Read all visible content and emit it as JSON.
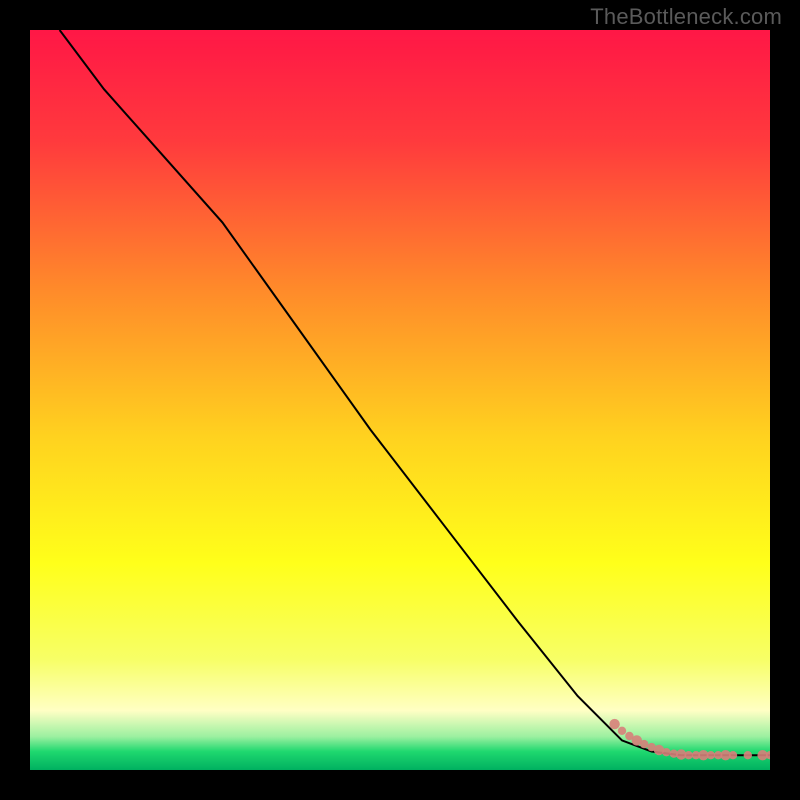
{
  "watermark": "TheBottleneck.com",
  "chart_data": {
    "type": "line",
    "title": "",
    "xlabel": "",
    "ylabel": "",
    "xlim": [
      0,
      100
    ],
    "ylim": [
      0,
      100
    ],
    "grid": false,
    "legend": false,
    "series": [
      {
        "name": "curve",
        "style": "line",
        "color": "#000000",
        "x": [
          4,
          10,
          18,
          26,
          36,
          46,
          56,
          66,
          74,
          80,
          84,
          88,
          92,
          96,
          100
        ],
        "values": [
          100,
          92,
          83,
          74,
          60,
          46,
          33,
          20,
          10,
          4,
          2.5,
          2,
          2,
          2,
          2
        ]
      },
      {
        "name": "bottom-markers",
        "style": "scatter",
        "color": "#d77f7a",
        "x": [
          79,
          80,
          81,
          82,
          83,
          84,
          85,
          86,
          87,
          88,
          89,
          90,
          91,
          92,
          93,
          94,
          95,
          97,
          99,
          100
        ],
        "values": [
          6.2,
          5.3,
          4.6,
          4.0,
          3.5,
          3.1,
          2.7,
          2.4,
          2.2,
          2.1,
          2.0,
          2.0,
          2.0,
          2.0,
          2.0,
          2.0,
          2.0,
          2.0,
          2.0,
          2.0
        ]
      }
    ],
    "background_gradient": {
      "direction": "vertical",
      "stops": [
        {
          "pos": 0.0,
          "color": "#ff1746"
        },
        {
          "pos": 0.15,
          "color": "#ff3a3d"
        },
        {
          "pos": 0.35,
          "color": "#ff8a2a"
        },
        {
          "pos": 0.55,
          "color": "#ffd21f"
        },
        {
          "pos": 0.72,
          "color": "#ffff1a"
        },
        {
          "pos": 0.85,
          "color": "#f7ff66"
        },
        {
          "pos": 0.92,
          "color": "#ffffc4"
        },
        {
          "pos": 0.955,
          "color": "#9bf0a0"
        },
        {
          "pos": 0.975,
          "color": "#1fd86f"
        },
        {
          "pos": 1.0,
          "color": "#00b060"
        }
      ]
    }
  }
}
